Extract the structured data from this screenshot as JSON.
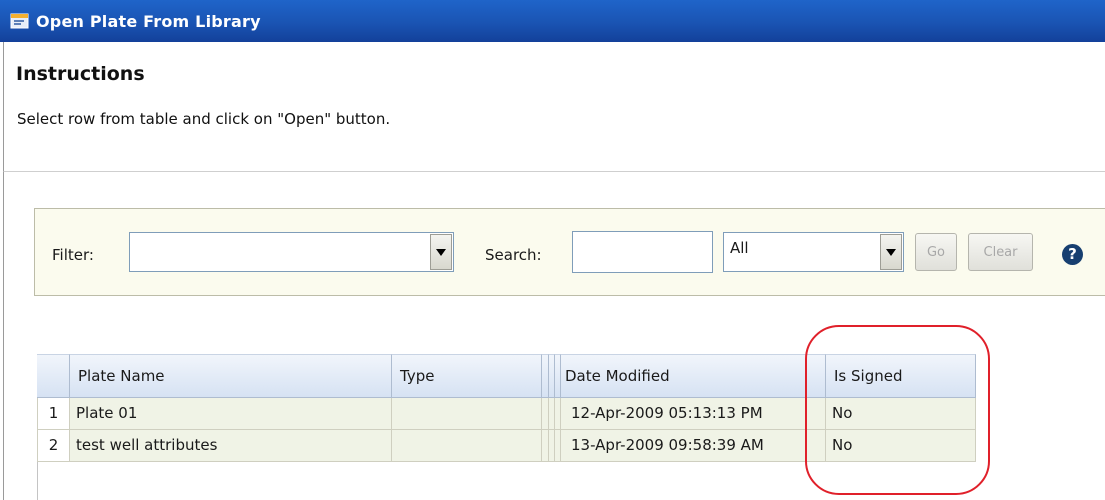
{
  "window": {
    "title": "Open Plate From Library"
  },
  "instructions": {
    "heading": "Instructions",
    "text": "Select row from table and click on \"Open\" button."
  },
  "filterbar": {
    "filter_label": "Filter:",
    "filter_value": "",
    "search_label": "Search:",
    "search_value": "",
    "scope_value": "All",
    "go_label": "Go",
    "clear_label": "Clear",
    "help_glyph": "?"
  },
  "table": {
    "columns": [
      "Plate Name",
      "Type",
      "",
      "",
      "",
      "Date Modified",
      "Is Signed"
    ],
    "rows": [
      {
        "num": "1",
        "plate_name": "Plate 01",
        "type": "",
        "date_modified": "12-Apr-2009 05:13:13 PM",
        "is_signed": "No"
      },
      {
        "num": "2",
        "plate_name": "test well attributes",
        "type": "",
        "date_modified": "13-Apr-2009 09:58:39 AM",
        "is_signed": "No"
      }
    ]
  },
  "colors": {
    "titlebar": "#1a54b3",
    "header": "#d6e2f3",
    "row": "#f0f3e6",
    "annotation": "#e0202a"
  },
  "icons": {
    "title_icon": "window-app-icon",
    "help_icon": "help-icon",
    "dropdown_icon": "chevron-down-icon"
  }
}
